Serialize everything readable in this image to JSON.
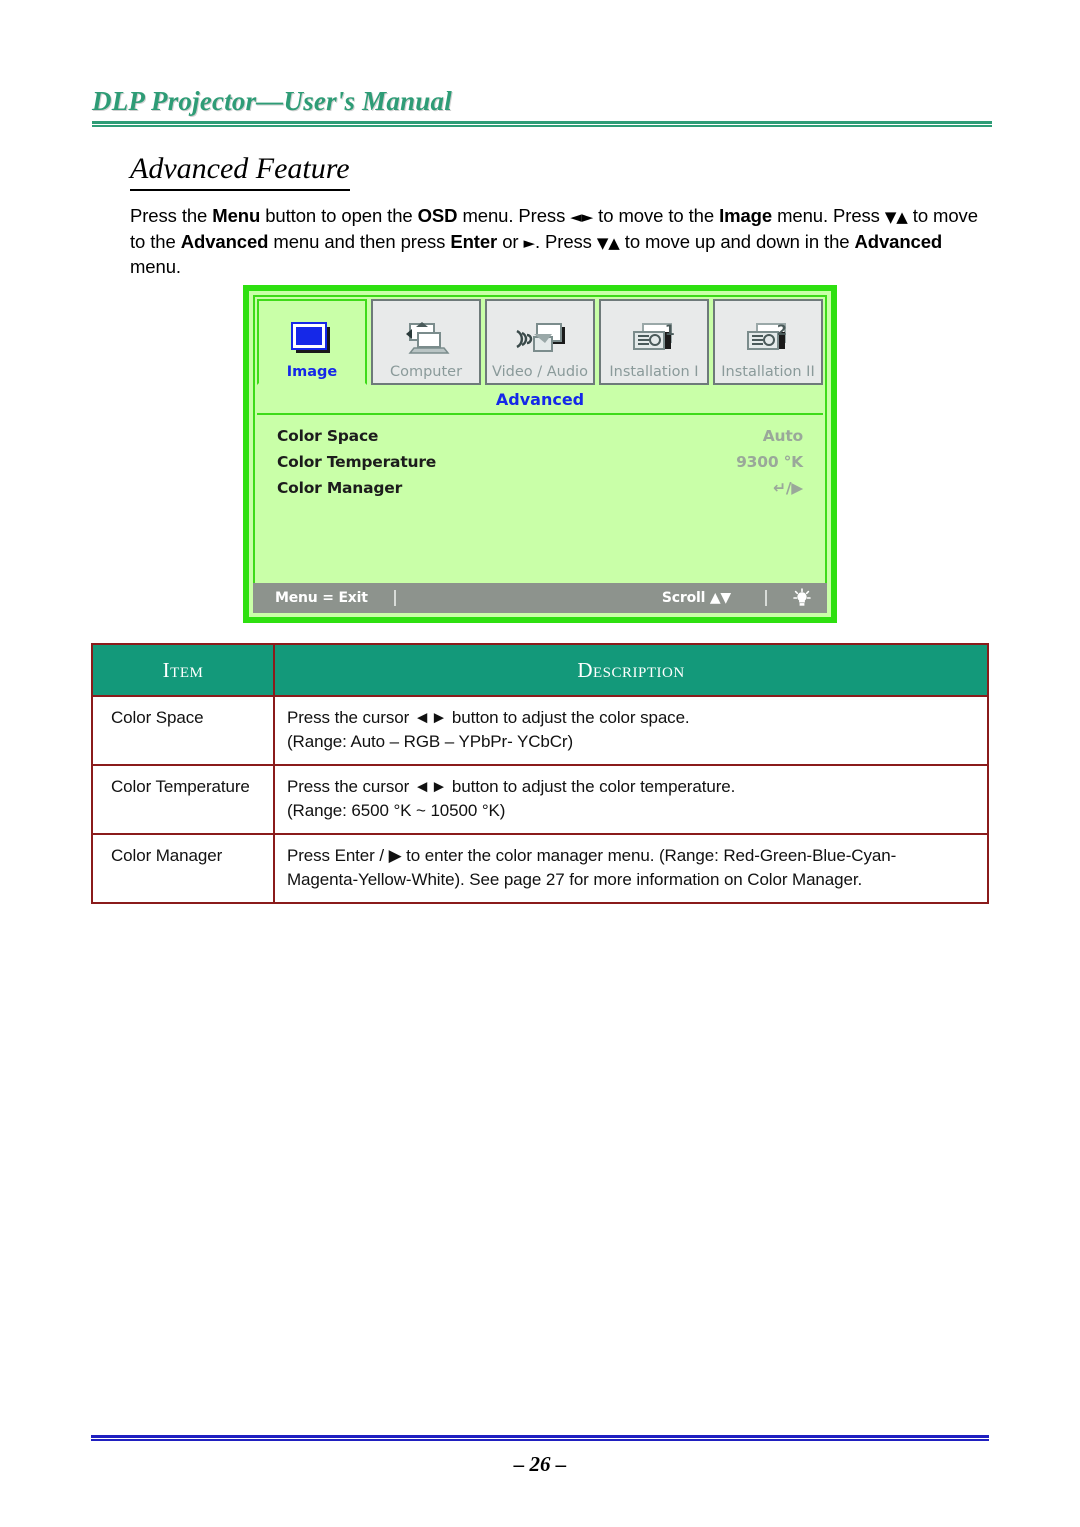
{
  "header": {
    "title": "DLP Projector—User's Manual"
  },
  "section": {
    "title": "Advanced Feature"
  },
  "intro": {
    "p1_a": "Press the ",
    "p1_menu": "Menu",
    "p1_b": " button to open the ",
    "p1_osd": "OSD",
    "p1_c": " menu. Press ",
    "p1_lr": "◄►",
    "p1_d": " to move to the ",
    "p1_image": "Image",
    "p1_e": " menu. Press ",
    "p1_du": "▼▲",
    "p1_f": " to move to the ",
    "p1_advanced": "Advanced",
    "p1_g": " menu and then press ",
    "p1_enter": "Enter",
    "p1_h": " or ",
    "p1_right": "►",
    "p1_i": ". Press ",
    "p1_du2": "▼▲",
    "p1_j": " to move up and down in the ",
    "p1_advanced2": "Advanced",
    "p1_k": " menu."
  },
  "osd": {
    "tabs": [
      {
        "label": "Image",
        "icon": "image-screen-icon",
        "active": true
      },
      {
        "label": "Computer",
        "icon": "computer-laptop-icon",
        "active": false
      },
      {
        "label": "Video / Audio",
        "icon": "video-audio-icon",
        "active": false
      },
      {
        "label": "Installation I",
        "icon": "installation-one-icon",
        "active": false
      },
      {
        "label": "Installation II",
        "icon": "installation-two-icon",
        "active": false
      }
    ],
    "submenu_title": "Advanced",
    "rows": [
      {
        "label": "Color Space",
        "value": "Auto"
      },
      {
        "label": "Color Temperature",
        "value": "9300 °K"
      },
      {
        "label": "Color Manager",
        "value": "↵/▶"
      }
    ],
    "footer": {
      "exit": "Menu = Exit",
      "scroll": "Scroll ▲▼",
      "lamp_icon": "lightbulb-icon"
    },
    "colors": {
      "panel_bg": "#c9ffa8",
      "border": "#2ee010",
      "accent_text": "#1528e8",
      "value_text": "#9aa89a",
      "footer_bg": "#8d938d"
    }
  },
  "table": {
    "headers": [
      "Item",
      "Description"
    ],
    "rows": [
      {
        "item": "Color Space",
        "desc_lines": [
          "Press the cursor ◄► button to adjust the color space.",
          "(Range: Auto – RGB – YPbPr- YCbCr)"
        ]
      },
      {
        "item": "Color Temperature",
        "desc_lines": [
          "Press the cursor ◄► button to adjust the color temperature.",
          "(Range: 6500 °K ~ 10500 °K)"
        ]
      },
      {
        "item": "Color Manager",
        "desc_lines": [
          "Press Enter / ▶ to enter the color manager menu. (Range: Red-Green-Blue-Cyan-",
          "Magenta-Yellow-White). See page 27 for more information on Color Manager."
        ]
      }
    ],
    "header_bg": "#13997a",
    "border_color": "#8a1b1b"
  },
  "footer": {
    "page_number": "– 26 –",
    "rule_color": "#2020c0"
  }
}
